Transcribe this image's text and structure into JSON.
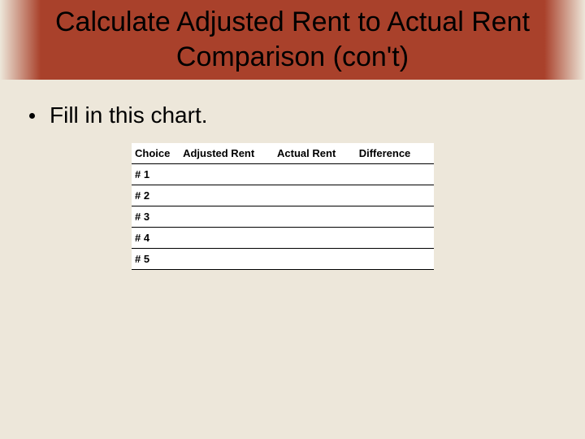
{
  "title": "Calculate Adjusted Rent to Actual Rent Comparison (con't)",
  "bullet": "Fill in this chart.",
  "chart_data": {
    "type": "table",
    "columns": [
      "Choice",
      "Adjusted Rent",
      "Actual Rent",
      "Difference"
    ],
    "rows": [
      {
        "choice": "# 1",
        "adjusted_rent": "",
        "actual_rent": "",
        "difference": ""
      },
      {
        "choice": "# 2",
        "adjusted_rent": "",
        "actual_rent": "",
        "difference": ""
      },
      {
        "choice": "# 3",
        "adjusted_rent": "",
        "actual_rent": "",
        "difference": ""
      },
      {
        "choice": "# 4",
        "adjusted_rent": "",
        "actual_rent": "",
        "difference": ""
      },
      {
        "choice": "# 5",
        "adjusted_rent": "",
        "actual_rent": "",
        "difference": ""
      }
    ]
  }
}
